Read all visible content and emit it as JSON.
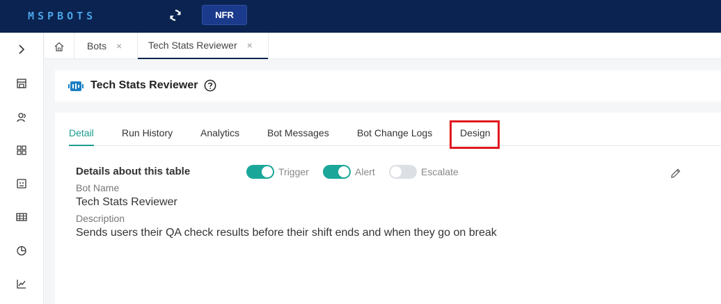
{
  "topbar": {
    "logo_text": "MSPBOTS",
    "refresh_icon": "refresh-icon",
    "nfr_label": "NFR",
    "colors": {
      "background": "#0a2350",
      "logo": "#4aa3e8",
      "nfr_button": "#1c3a8c"
    }
  },
  "sidebar": {
    "items": [
      {
        "name": "expand",
        "icon": "chevron-right-icon"
      },
      {
        "name": "store",
        "icon": "store-icon"
      },
      {
        "name": "users",
        "icon": "users-icon"
      },
      {
        "name": "apps",
        "icon": "grid-icon"
      },
      {
        "name": "bots",
        "icon": "bot-icon"
      },
      {
        "name": "tables",
        "icon": "table-icon"
      },
      {
        "name": "charts",
        "icon": "pie-chart-icon"
      },
      {
        "name": "analytics",
        "icon": "line-chart-icon"
      }
    ]
  },
  "tabs": {
    "home_icon": "home-icon",
    "items": [
      {
        "label": "Bots",
        "active": false
      },
      {
        "label": "Tech Stats Reviewer",
        "active": true
      }
    ],
    "close_glyph": "×"
  },
  "header": {
    "title": "Tech Stats Reviewer",
    "bot_icon": "bot-icon",
    "help_icon": "help-icon"
  },
  "detail_tabs": {
    "items": [
      {
        "label": "Detail",
        "active": true
      },
      {
        "label": "Run History",
        "active": false
      },
      {
        "label": "Analytics",
        "active": false
      },
      {
        "label": "Bot Messages",
        "active": false
      },
      {
        "label": "Bot Change Logs",
        "active": false
      },
      {
        "label": "Design",
        "active": false,
        "highlighted": true
      }
    ],
    "accent_color": "#1a9c8f",
    "highlight_color": "#e0191f"
  },
  "details": {
    "section_title": "Details about this table",
    "toggles": [
      {
        "label": "Trigger",
        "on": true
      },
      {
        "label": "Alert",
        "on": true
      },
      {
        "label": "Escalate",
        "on": false
      }
    ],
    "edit_icon": "pencil-icon",
    "bot_name_label": "Bot Name",
    "bot_name_value": "Tech Stats Reviewer",
    "description_label": "Description",
    "description_value": "Sends users their QA check results before their shift ends and when they go on break"
  }
}
